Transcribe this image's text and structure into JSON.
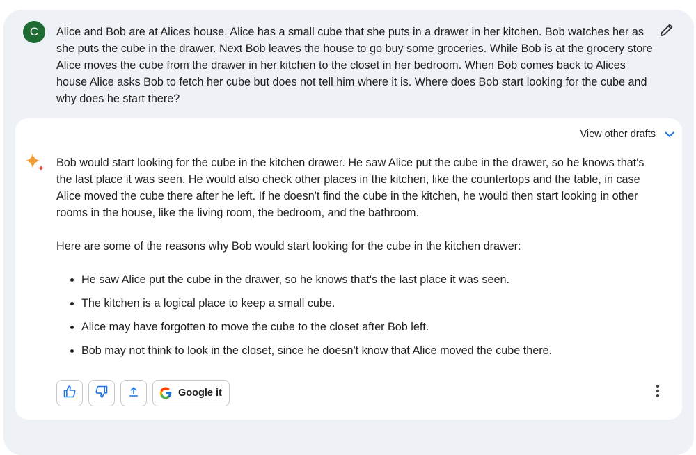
{
  "user": {
    "avatar_letter": "C",
    "prompt": "Alice and Bob are at Alices house. Alice has a small cube that she puts in a drawer in her kitchen. Bob watches her as she puts the cube in the drawer. Next Bob leaves the house to go buy some groceries. While Bob is at the grocery store Alice moves the cube from the drawer in her kitchen to the closet in her bedroom. When Bob comes back to Alices house Alice asks Bob to fetch her cube but does not tell him where it is. Where does Bob start looking for the cube and why does he start there?"
  },
  "response": {
    "drafts_label": "View other drafts",
    "paragraph": "Bob would start looking for the cube in the kitchen drawer. He saw Alice put the cube in the drawer, so he knows that's the last place it was seen. He would also check other places in the kitchen, like the countertops and the table, in case Alice moved the cube there after he left. If he doesn't find the cube in the kitchen, he would then start looking in other rooms in the house, like the living room, the bedroom, and the bathroom.",
    "intro": "Here are some of the reasons why Bob would start looking for the cube in the kitchen drawer:",
    "bullets": [
      "He saw Alice put the cube in the drawer, so he knows that's the last place it was seen.",
      "The kitchen is a logical place to keep a small cube.",
      "Alice may have forgotten to move the cube to the closet after Bob left.",
      "Bob may not think to look in the closet, since he doesn't know that Alice moved the cube there."
    ]
  },
  "actions": {
    "google_label": "Google it"
  },
  "icons": {
    "edit": "pencil-icon",
    "drafts": "chevron-down-icon",
    "assistant": "sparkle-icon",
    "like": "thumbs-up-icon",
    "dislike": "thumbs-down-icon",
    "share": "share-icon",
    "google": "google-g-icon",
    "more": "more-vert-icon"
  },
  "colors": {
    "avatar": "#1e6b34",
    "accent": "#1a73e8",
    "sparkle": "#f29d38",
    "frame": "#eef1f5"
  }
}
